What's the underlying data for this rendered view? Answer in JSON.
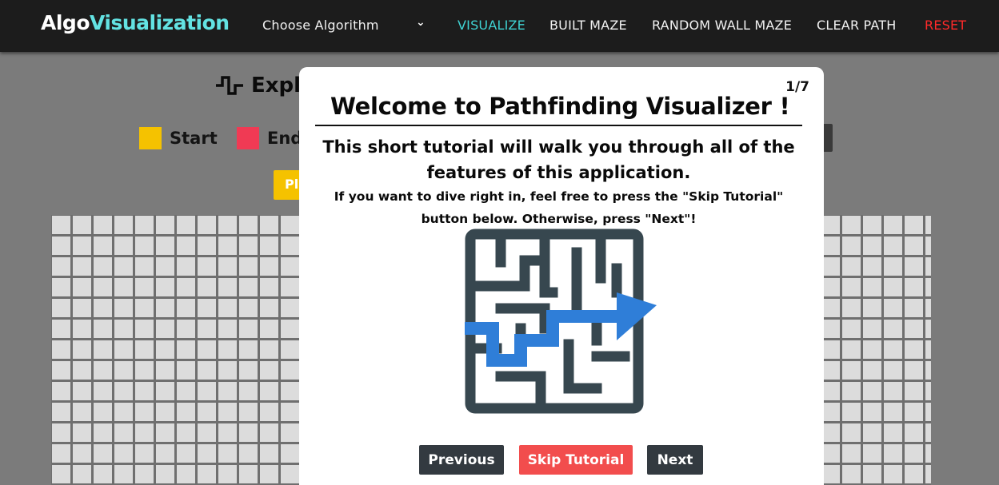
{
  "navbar": {
    "brand_part1": "Algo",
    "brand_part2": "Visualization",
    "choose_algorithm": "Choose Algorithm",
    "chevron": "⌄",
    "visualize": "VISUALIZE",
    "built_maze": "BUILT MAZE",
    "random_wall_maze": "RANDOM WALL MAZE",
    "clear_path": "CLEAR PATH",
    "reset": "RESET"
  },
  "background": {
    "explore_title": "Expl",
    "legend": [
      {
        "label": "Start",
        "color": "#f5c200"
      },
      {
        "label": "End",
        "color": "#f03a54"
      }
    ],
    "play_button": "Pl"
  },
  "modal": {
    "counter": "1/7",
    "title": "Welcome to Pathfinding Visualizer !",
    "subtitle": "This short tutorial will walk you through all of the features of this application.",
    "body": "If you want to dive right in, feel free to press the \"Skip Tutorial\" button below. Otherwise, press \"Next\"!",
    "image_icon": "maze-icon",
    "buttons": {
      "previous": "Previous",
      "skip": "Skip Tutorial",
      "next": "Next"
    }
  },
  "colors": {
    "accent": "#3fd2d2",
    "reset": "#ff2a2a",
    "skip_button": "#f24d4d",
    "dark_button": "#333a40",
    "maze_wall": "#37474f",
    "maze_path": "#2f7ed8"
  }
}
